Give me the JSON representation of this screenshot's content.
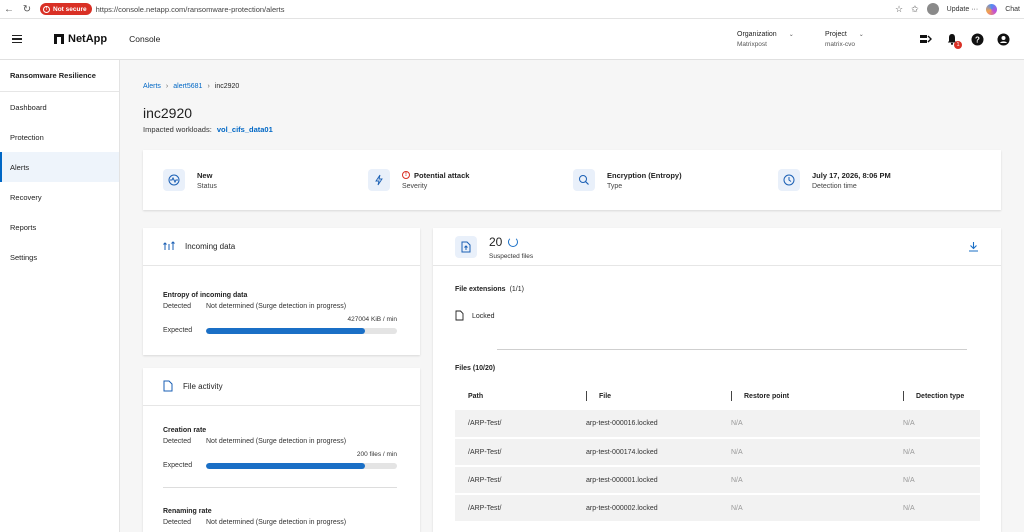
{
  "browser": {
    "security_label": "Not secure",
    "url": "https://console.netapp.com/ransomware-protection/alerts",
    "update_label": "Update",
    "chat_label": "Chat"
  },
  "header": {
    "brand": "NetApp",
    "app_label": "Console",
    "organization": {
      "label": "Organization",
      "value": "Matrixpost"
    },
    "project": {
      "label": "Project",
      "value": "matrix-cvo"
    },
    "notification_count": "1"
  },
  "sidebar": {
    "title": "Ransomware Resilience",
    "items": [
      {
        "label": "Dashboard"
      },
      {
        "label": "Protection"
      },
      {
        "label": "Alerts"
      },
      {
        "label": "Recovery"
      },
      {
        "label": "Reports"
      },
      {
        "label": "Settings"
      }
    ],
    "active": "Alerts"
  },
  "breadcrumb": [
    "Alerts",
    "alert5681",
    "inc2920"
  ],
  "page": {
    "title": "inc2920",
    "impacted_label": "Impacted workloads:",
    "impacted_value": "vol_cifs_data01"
  },
  "summary": [
    {
      "value": "New",
      "label": "Status",
      "icon": "pulse-icon"
    },
    {
      "value": "Potential attack",
      "label": "Severity",
      "icon": "lightning-icon"
    },
    {
      "value": "Encryption (Entropy)",
      "label": "Type",
      "icon": "encryption-icon"
    },
    {
      "value": "July 17, 2026, 8:06 PM",
      "label": "Detection time",
      "icon": "clock-icon"
    }
  ],
  "incoming": {
    "title": "Incoming data",
    "metric_title": "Entropy of incoming data",
    "detected_label": "Detected",
    "detected_value": "Not determined (Surge detection in progress)",
    "expected_label": "Expected",
    "value_text": "427004 KiB / min",
    "fill_fraction": 0.83
  },
  "activity": {
    "title": "File activity",
    "creation": {
      "metric_title": "Creation rate",
      "detected_label": "Detected",
      "detected_value": "Not determined (Surge detection in progress)",
      "expected_label": "Expected",
      "value_text": "200 files / min",
      "fill_fraction": 0.83
    },
    "renaming": {
      "metric_title": "Renaming rate",
      "detected_label": "Detected",
      "detected_value": "Not determined (Surge detection in progress)"
    }
  },
  "files": {
    "count": "20",
    "count_label": "Suspected files",
    "extensions_title": "File extensions",
    "extensions_count": "(1/1)",
    "extension": "Locked",
    "files_title": "Files (10/20)",
    "columns": [
      "Path",
      "File",
      "Restore point",
      "Detection type"
    ],
    "rows": [
      [
        "/ARP-Test/",
        "arp-test-000016.locked",
        "N/A",
        "N/A"
      ],
      [
        "/ARP-Test/",
        "arp-test-000174.locked",
        "N/A",
        "N/A"
      ],
      [
        "/ARP-Test/",
        "arp-test-000001.locked",
        "N/A",
        "N/A"
      ],
      [
        "/ARP-Test/",
        "arp-test-000002.locked",
        "N/A",
        "N/A"
      ]
    ]
  }
}
